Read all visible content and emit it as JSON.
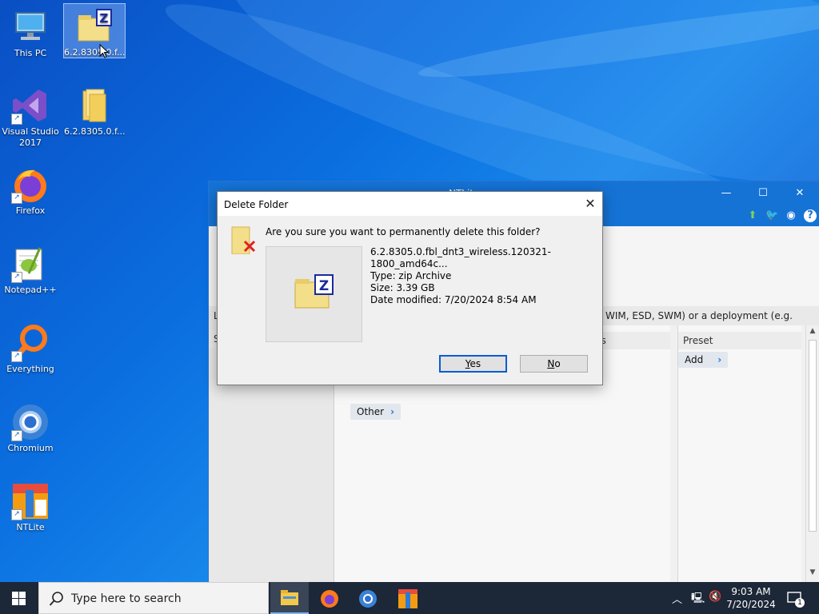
{
  "desktop": {
    "icons": [
      {
        "label": "This PC"
      },
      {
        "label": "6.2.8305.0.f..."
      },
      {
        "label": "Visual Studio 2017"
      },
      {
        "label": "6.2.8305.0.f..."
      },
      {
        "label": "Firefox"
      },
      {
        "label": "Notepad++"
      },
      {
        "label": "Everything"
      },
      {
        "label": "Chromium"
      },
      {
        "label": "NTLite"
      }
    ]
  },
  "ntlite": {
    "title": "NTLite",
    "infobar_left": "L",
    "infobar_right": "WIM, ESD, SWM) or a deployment (e.g. C:\\Wind...",
    "col_left": "S",
    "col_mid": "ns",
    "col_preset": "Preset",
    "add_label": "Add",
    "other_label": "Other"
  },
  "dialog": {
    "title": "Delete Folder",
    "question": "Are you sure you want to permanently delete this folder?",
    "file_name": "6.2.8305.0.fbl_dnt3_wireless.120321-1800_amd64c...",
    "file_type": "Type: zip Archive",
    "file_size": "Size: 3.39 GB",
    "file_date": "Date modified: 7/20/2024 8:54 AM",
    "yes_letter": "Y",
    "yes_rest": "es",
    "no_letter": "N",
    "no_rest": "o"
  },
  "taskbar": {
    "search_placeholder": "Type here to search",
    "time": "9:03 AM",
    "date": "7/20/2024",
    "notification_count": "1"
  }
}
